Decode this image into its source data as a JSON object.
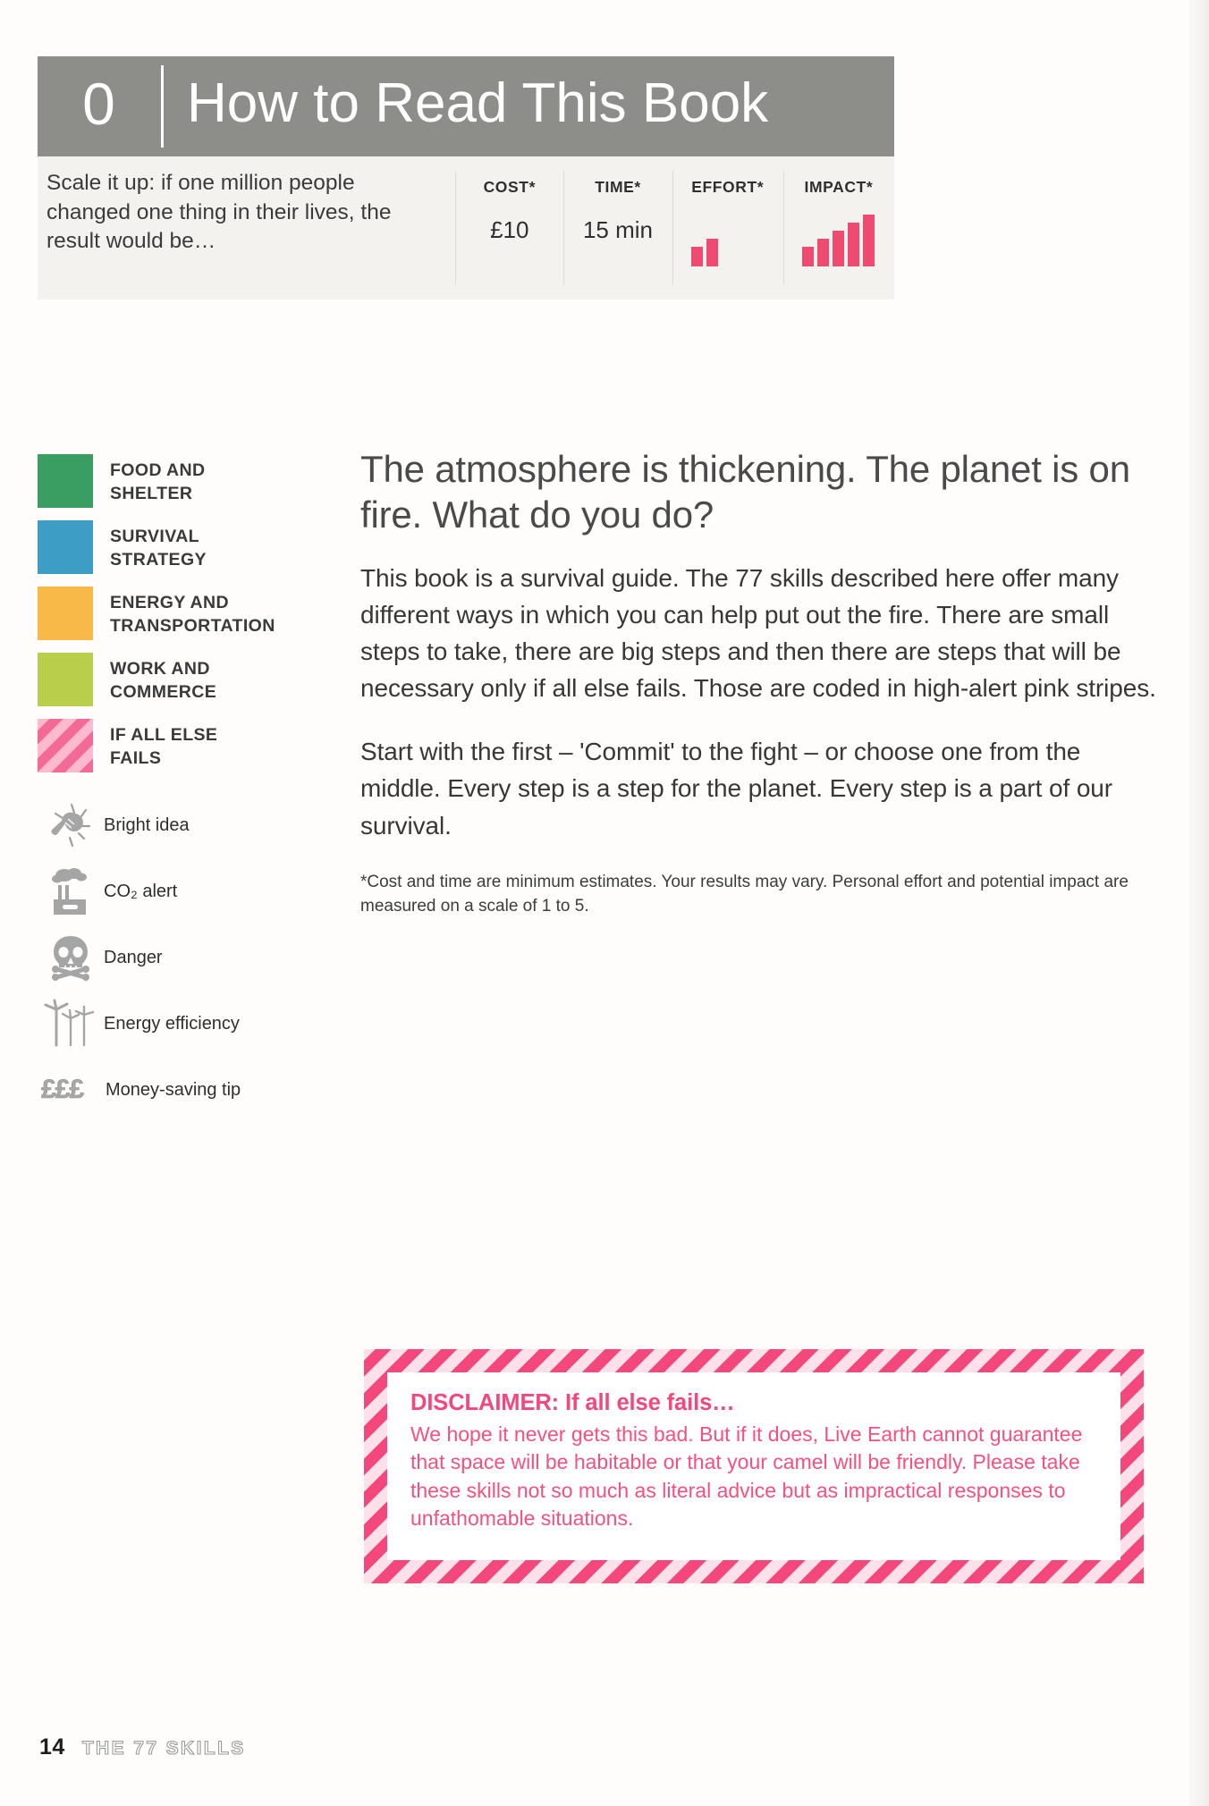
{
  "header": {
    "chapter_number": "0",
    "title": "How to Read This Book"
  },
  "stats": {
    "intro": "Scale it up: if one million people changed one thing in their lives, the result would be…",
    "columns": [
      {
        "label": "COST*",
        "value": "£10",
        "type": "text"
      },
      {
        "label": "TIME*",
        "value": "15 min",
        "type": "text"
      },
      {
        "label": "EFFORT*",
        "value": 2,
        "type": "meter",
        "max": 5
      },
      {
        "label": "IMPACT*",
        "value": 5,
        "type": "meter",
        "max": 5
      }
    ],
    "accent_color": "#ef4b70"
  },
  "legend": {
    "categories": [
      {
        "label": "FOOD AND SHELTER",
        "color": "#3a9e62",
        "striped": false
      },
      {
        "label": "SURVIVAL STRATEGY",
        "color": "#3e9dc4",
        "striped": false
      },
      {
        "label": "ENERGY AND TRANSPORTATION",
        "color": "#f9b948",
        "striped": false
      },
      {
        "label": "WORK AND COMMERCE",
        "color": "#b9ce4b",
        "striped": false
      },
      {
        "label": "IF ALL ELSE FAILS",
        "color": "#f46a96",
        "striped": true
      }
    ],
    "icons": [
      {
        "icon": "lightbulb-icon",
        "label": "Bright idea"
      },
      {
        "icon": "factory-smoke-icon",
        "label": "CO₂ alert"
      },
      {
        "icon": "skull-crossbones-icon",
        "label": "Danger"
      },
      {
        "icon": "wind-turbine-icon",
        "label": "Energy efficiency"
      },
      {
        "icon": "money-pounds-icon",
        "label": "Money-saving tip",
        "glyph": "£££"
      }
    ]
  },
  "main": {
    "headline": "The atmosphere is thickening. The planet is on fire. What do you do?",
    "paragraph_1": "This book is a survival guide. The 77 skills described here offer many different ways in which you can help put out the fire. There are small steps to take, there are big steps and then there are steps that will be necessary only if all else fails. Those are coded in high-alert pink stripes.",
    "paragraph_2": "Start with the first – 'Commit' to the fight – or choose one from the middle. Every step is a step for the planet. Every step is a part of our survival.",
    "footnote": "*Cost and time are minimum estimates. Your results may vary. Personal effort and potential impact are measured on a scale of 1 to 5."
  },
  "disclaimer": {
    "title": "DISCLAIMER: If all else fails…",
    "body": "We hope it never gets this bad. But if it does, Live Earth cannot guarantee that space will be habitable or that your camel will be friendly. Please take these skills not so much as literal advice but as impractical responses to unfathomable situations.",
    "color": "#f4487c"
  },
  "footer": {
    "page_number": "14",
    "book_title": "THE 77 SKILLS"
  }
}
